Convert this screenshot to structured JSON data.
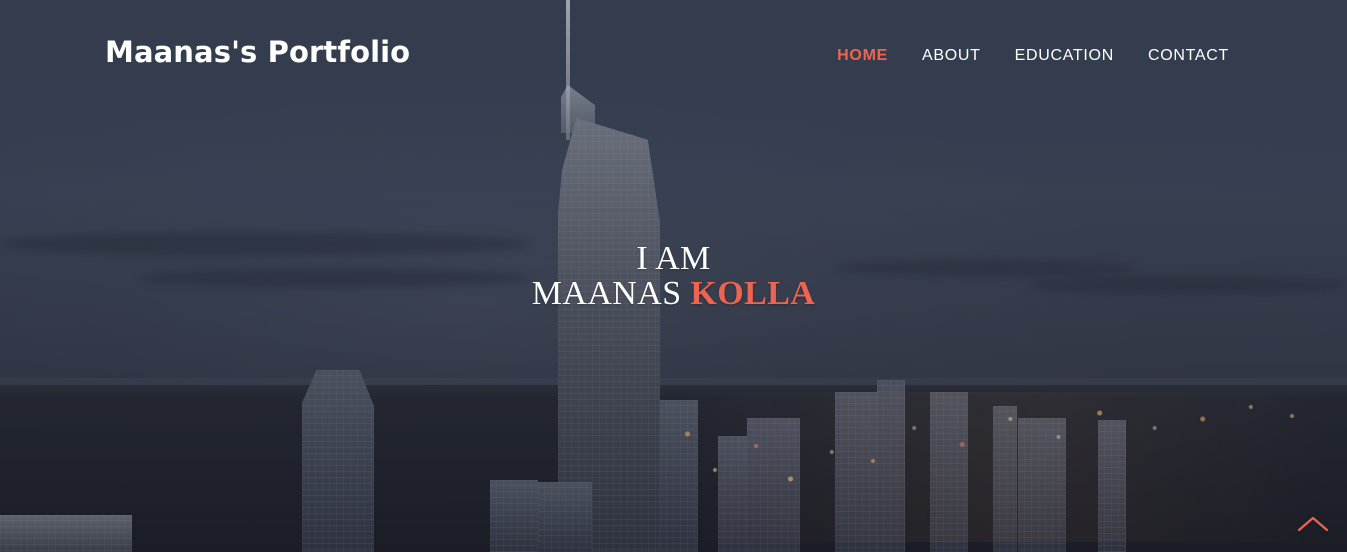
{
  "header": {
    "brand": "Maanas's Portfolio"
  },
  "nav": {
    "items": [
      {
        "label": "HOME",
        "active": true
      },
      {
        "label": "ABOUT",
        "active": false
      },
      {
        "label": "EDUCATION",
        "active": false
      },
      {
        "label": "CONTACT",
        "active": false
      }
    ]
  },
  "hero": {
    "line1": "I AM",
    "name_first": "MAANAS",
    "name_last": "KOLLA"
  },
  "colors": {
    "accent": "#ef6451",
    "text": "#ffffff"
  },
  "icons": {
    "scroll_top": "chevron-up-icon"
  }
}
